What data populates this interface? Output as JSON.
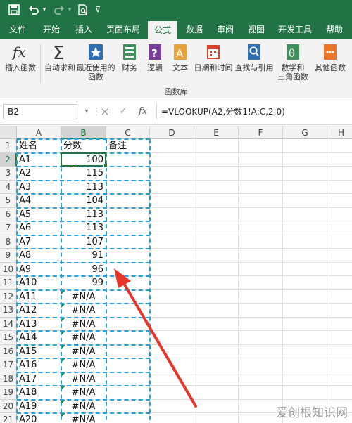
{
  "quick_access": {
    "save_icon": "save-icon",
    "undo_icon": "undo-icon",
    "redo_icon": "redo-icon",
    "print_preview_icon": "print-preview-icon",
    "customize_icon": "customize-icon"
  },
  "tabs": [
    "文件",
    "开始",
    "插入",
    "页面布局",
    "公式",
    "数据",
    "审阅",
    "视图",
    "开发工具",
    "帮助"
  ],
  "active_tab": "公式",
  "ribbon": {
    "buttons": [
      {
        "label": "插入函数",
        "icon": "fx-icon"
      },
      {
        "label": "自动求和",
        "icon": "sigma-icon"
      },
      {
        "label": "最近使用的\n函数",
        "icon": "recent-star-icon"
      },
      {
        "label": "财务",
        "icon": "finance-icon"
      },
      {
        "label": "逻辑",
        "icon": "logic-icon"
      },
      {
        "label": "文本",
        "icon": "text-icon"
      },
      {
        "label": "日期和时间",
        "icon": "datetime-icon"
      },
      {
        "label": "查找与引用",
        "icon": "lookup-icon"
      },
      {
        "label": "数学和\n三角函数",
        "icon": "math-icon"
      },
      {
        "label": "其他函数",
        "icon": "more-functions-icon"
      }
    ],
    "group_label": "函数库"
  },
  "formula_bar": {
    "name_box": "B2",
    "cancel_icon": "×",
    "enter_icon": "✓",
    "fx_icon": "fx",
    "formula": "=VLOOKUP(A2,分数1!A:C,2,0)"
  },
  "columns": [
    "A",
    "B",
    "C",
    "D",
    "E",
    "F",
    "G",
    "H"
  ],
  "rows": [
    {
      "n": "1",
      "a": "姓名",
      "b": "分数",
      "c": "备注"
    },
    {
      "n": "2",
      "a": "A1",
      "b": "100"
    },
    {
      "n": "3",
      "a": "A2",
      "b": "115"
    },
    {
      "n": "4",
      "a": "A3",
      "b": "113"
    },
    {
      "n": "5",
      "a": "A4",
      "b": "104"
    },
    {
      "n": "6",
      "a": "A5",
      "b": "113"
    },
    {
      "n": "7",
      "a": "A6",
      "b": "113"
    },
    {
      "n": "8",
      "a": "A7",
      "b": "107"
    },
    {
      "n": "9",
      "a": "A8",
      "b": "91"
    },
    {
      "n": "10",
      "a": "A9",
      "b": "96"
    },
    {
      "n": "11",
      "a": "A10",
      "b": "99"
    },
    {
      "n": "12",
      "a": "A11",
      "b": "#N/A"
    },
    {
      "n": "13",
      "a": "A12",
      "b": "#N/A"
    },
    {
      "n": "14",
      "a": "A13",
      "b": "#N/A"
    },
    {
      "n": "15",
      "a": "A14",
      "b": "#N/A"
    },
    {
      "n": "16",
      "a": "A15",
      "b": "#N/A"
    },
    {
      "n": "17",
      "a": "A16",
      "b": "#N/A"
    },
    {
      "n": "18",
      "a": "A17",
      "b": "#N/A"
    },
    {
      "n": "19",
      "a": "A18",
      "b": "#N/A"
    },
    {
      "n": "20",
      "a": "A19",
      "b": "#N/A"
    },
    {
      "n": "21",
      "a": "A20",
      "b": "#N/A"
    }
  ],
  "selected_cell": "B2",
  "annotation": {
    "arrow_color": "#e8352a",
    "selection_dash_color": "#2aa0d8"
  },
  "watermark": "爱创根知识网",
  "colors": {
    "excel_green": "#217346"
  }
}
